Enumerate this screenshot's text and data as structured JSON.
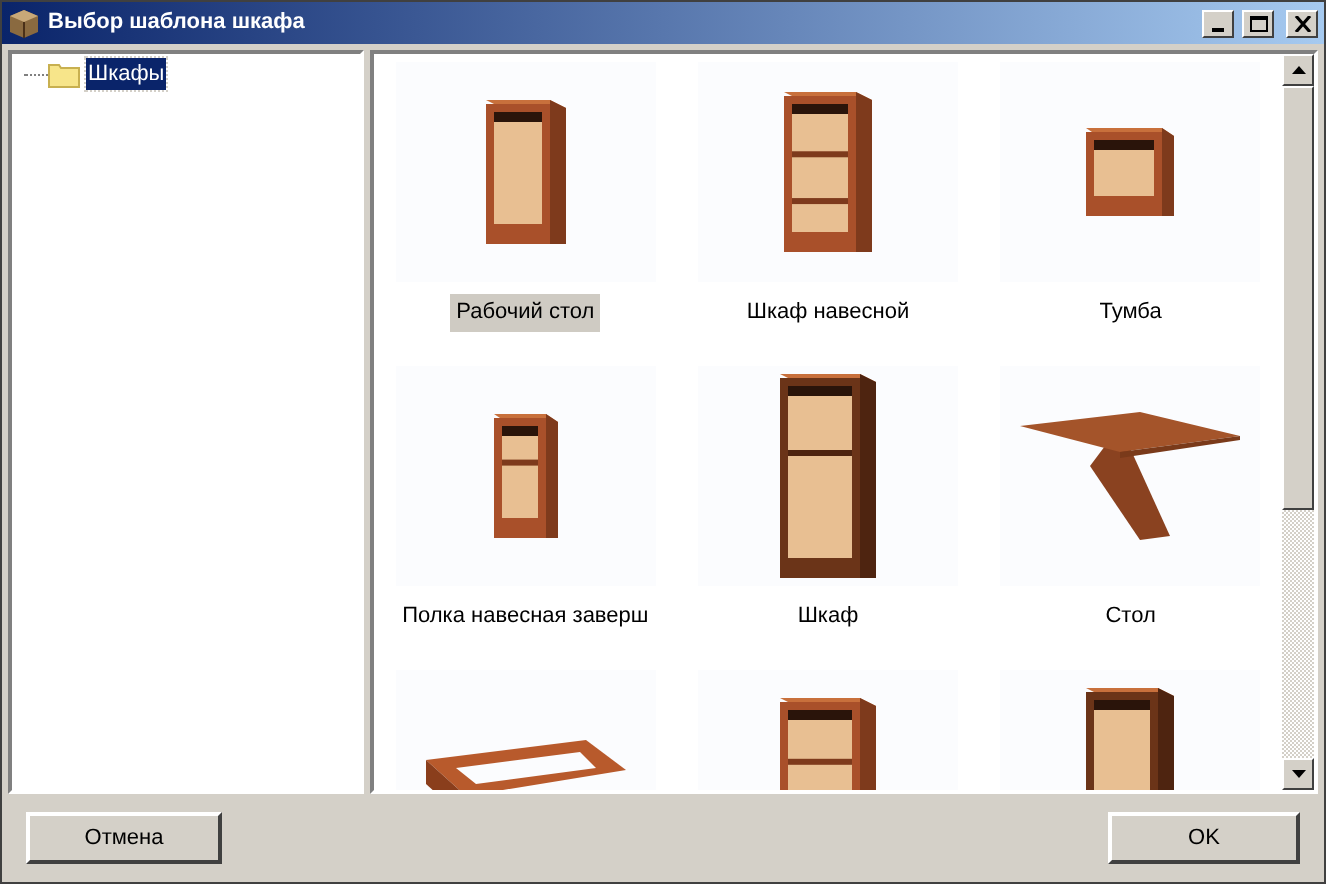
{
  "window": {
    "title": "Выбор шаблона шкафа"
  },
  "tree": {
    "items": [
      {
        "label": "Шкафы",
        "selected": true
      }
    ]
  },
  "templates": [
    {
      "label": "Рабочий стол",
      "selected": true
    },
    {
      "label": "Шкаф навесной",
      "selected": false
    },
    {
      "label": "Тумба",
      "selected": false
    },
    {
      "label": "Полка навесная заверш",
      "selected": false
    },
    {
      "label": "Шкаф",
      "selected": false
    },
    {
      "label": "Стол",
      "selected": false
    },
    {
      "selected": false
    },
    {
      "selected": false
    },
    {
      "selected": false
    }
  ],
  "buttons": {
    "cancel": "Отмена",
    "ok": "OK"
  }
}
